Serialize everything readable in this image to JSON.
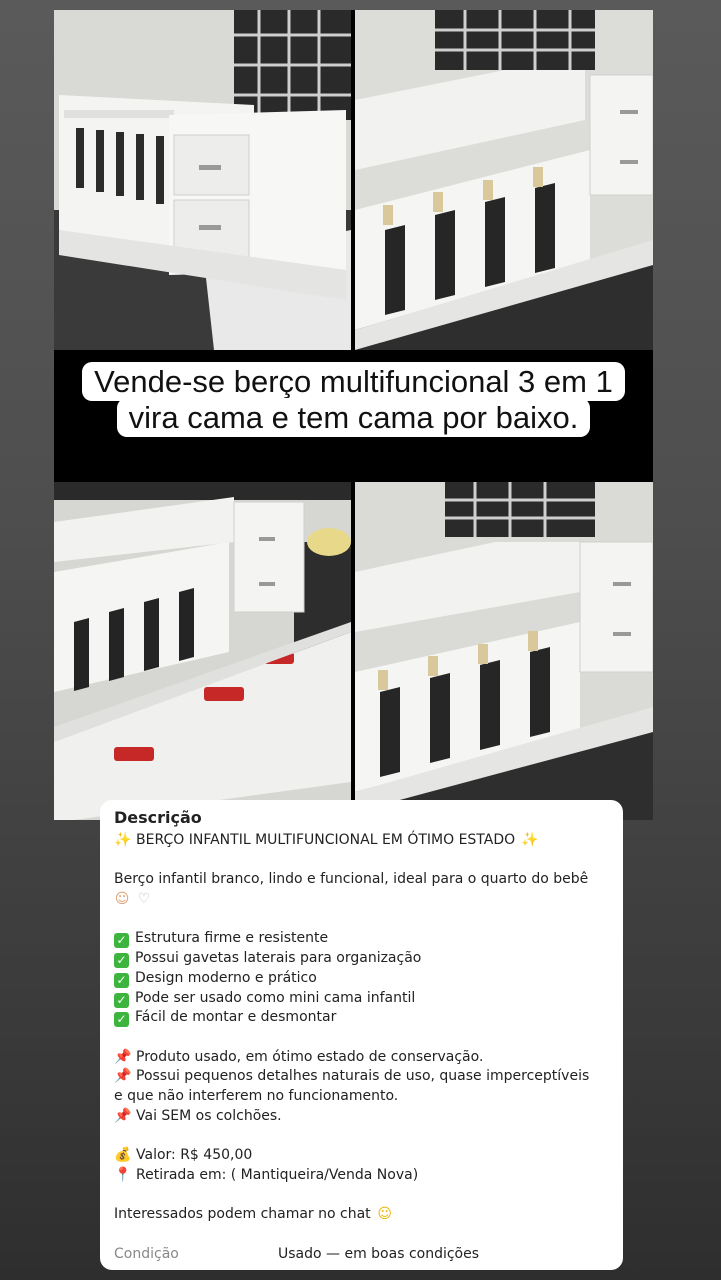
{
  "headline": "Vende-se berço multifuncional 3 em 1 vira cama e tem cama por baixo.",
  "description": {
    "title": "Descrição",
    "heading": "BERÇO INFANTIL MULTIFUNCIONAL EM ÓTIMO ESTADO",
    "intro": "Berço infantil branco, lindo e funcional, ideal para o quarto do bebê",
    "features": [
      "Estrutura firme e resistente",
      "Possui gavetas laterais para organização",
      "Design moderno e prático",
      "Pode ser usado como mini cama infantil",
      "Fácil de montar e desmontar"
    ],
    "notes": [
      "Produto usado, em ótimo estado de conservação.",
      "Possui pequenos detalhes naturais de uso, quase imperceptíveis",
      "e que não interferem no funcionamento.",
      "Vai SEM os colchões."
    ],
    "price": "Valor: R$ 450,00",
    "pickup": "Retirada em: ( Mantiqueira/Venda Nova)",
    "contact": "Interessados podem chamar no chat"
  },
  "condition": {
    "label": "Condição",
    "value": "Usado — em boas condições"
  },
  "icons": {
    "sparkles": "sparkles-icon",
    "baby": "baby-face-icon",
    "heart": "white-heart-icon",
    "check": "check-mark-icon",
    "pin": "pushpin-icon",
    "money": "money-bag-icon",
    "location": "location-pin-icon",
    "smile": "smiling-face-icon"
  },
  "colors": {
    "check_green": "#3db43d",
    "card_bg": "#ffffff"
  }
}
